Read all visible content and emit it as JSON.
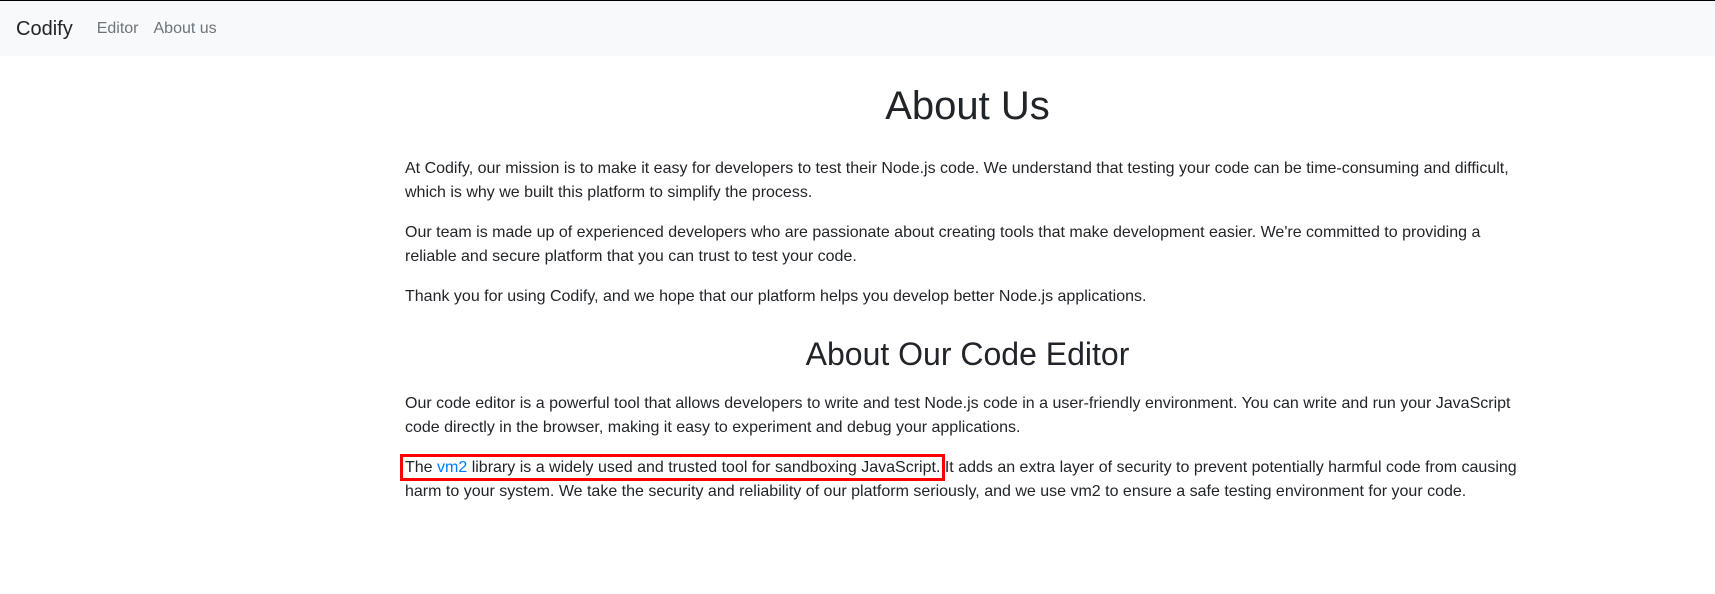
{
  "navbar": {
    "brand": "Codify",
    "links": [
      {
        "label": "Editor"
      },
      {
        "label": "About us"
      }
    ]
  },
  "main": {
    "title": "About Us",
    "paragraphs": [
      "At Codify, our mission is to make it easy for developers to test their Node.js code. We understand that testing your code can be time-consuming and difficult, which is why we built this platform to simplify the process.",
      "Our team is made up of experienced developers who are passionate about creating tools that make development easier. We're committed to providing a reliable and secure platform that you can trust to test your code.",
      "Thank you for using Codify, and we hope that our platform helps you develop better Node.js applications."
    ],
    "editor_section": {
      "title": "About Our Code Editor",
      "paragraph1": "Our code editor is a powerful tool that allows developers to write and test Node.js code in a user-friendly environment. You can write and run your JavaScript code directly in the browser, making it easy to experiment and debug your applications.",
      "paragraph2": {
        "prefix": "The ",
        "link_text": "vm2",
        "highlight_rest": " library is a widely used and trusted tool for sandboxing JavaScript.",
        "suffix": " It adds an extra layer of security to prevent potentially harmful code from causing harm to your system. We take the security and reliability of our platform seriously, and we use vm2 to ensure a safe testing environment for your code."
      }
    }
  },
  "colors": {
    "navbar_bg": "#f8f9fa",
    "link": "#007bff",
    "highlight_border": "#ff0000",
    "text": "#212529",
    "nav_link": "#6c757d"
  }
}
